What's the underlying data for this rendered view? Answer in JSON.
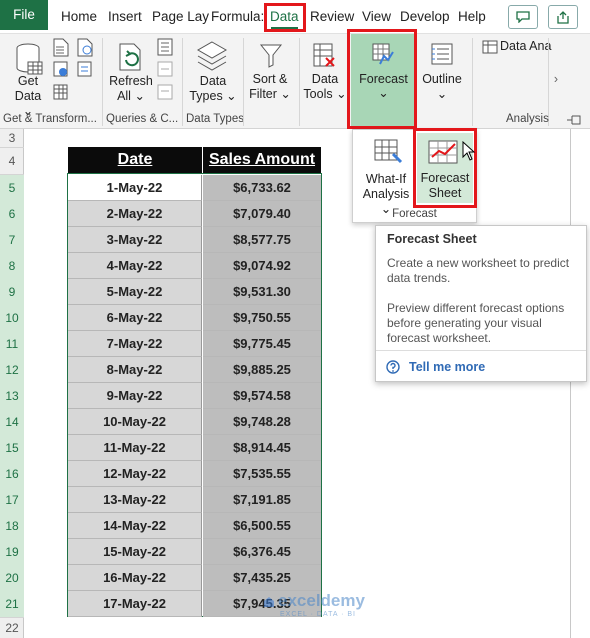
{
  "menu": {
    "tabs": [
      "File",
      "Home",
      "Insert",
      "Page Lay",
      "Formula:",
      "Data",
      "Review",
      "View",
      "Develop",
      "Help"
    ]
  },
  "ribbon": {
    "get_data": "Get",
    "get_data2": "Data",
    "refresh": "Refresh",
    "refresh2": "All",
    "data_types": "Data",
    "data_types2": "Types",
    "sort_filter": "Sort &",
    "sort_filter2": "Filter",
    "data_tools": "Data",
    "data_tools2": "Tools",
    "forecast": "Forecast",
    "outline": "Outline",
    "data_analysis": "Data Ana",
    "group_get_transform": "Get & Transform...",
    "group_queries": "Queries & C...",
    "group_data_types": "Data Types",
    "group_analysis": "Analysis"
  },
  "dropdown": {
    "what_if": "What-If",
    "what_if2": "Analysis",
    "forecast_sheet": "Forecast",
    "forecast_sheet2": "Sheet",
    "group_label": "Forecast"
  },
  "tooltip": {
    "title": "Forecast Sheet",
    "desc1": "Create a new worksheet to predict data trends.",
    "desc2": "Preview different forecast options before generating your visual forecast worksheet.",
    "link": "Tell me more"
  },
  "rows": [
    "3",
    "4",
    "5",
    "6",
    "7",
    "8",
    "9",
    "10",
    "11",
    "12",
    "13",
    "14",
    "15",
    "16",
    "17",
    "18",
    "19",
    "20",
    "21",
    "22"
  ],
  "table": {
    "header_date": "Date",
    "header_amount": "Sales Amount",
    "records": [
      {
        "date": "1-May-22",
        "amount": "$6,733.62"
      },
      {
        "date": "2-May-22",
        "amount": "$7,079.40"
      },
      {
        "date": "3-May-22",
        "amount": "$8,577.75"
      },
      {
        "date": "4-May-22",
        "amount": "$9,074.92"
      },
      {
        "date": "5-May-22",
        "amount": "$9,531.30"
      },
      {
        "date": "6-May-22",
        "amount": "$9,750.55"
      },
      {
        "date": "7-May-22",
        "amount": "$9,775.45"
      },
      {
        "date": "8-May-22",
        "amount": "$9,885.25"
      },
      {
        "date": "9-May-22",
        "amount": "$9,574.58"
      },
      {
        "date": "10-May-22",
        "amount": "$9,748.28"
      },
      {
        "date": "11-May-22",
        "amount": "$8,914.45"
      },
      {
        "date": "12-May-22",
        "amount": "$7,535.55"
      },
      {
        "date": "13-May-22",
        "amount": "$7,191.85"
      },
      {
        "date": "14-May-22",
        "amount": "$6,500.55"
      },
      {
        "date": "15-May-22",
        "amount": "$6,376.45"
      },
      {
        "date": "16-May-22",
        "amount": "$7,435.25"
      },
      {
        "date": "17-May-22",
        "amount": "$7,945.35"
      }
    ]
  },
  "watermark": "exceldemy",
  "watermark_sub": "EXCEL · DATA · BI",
  "colors": {
    "accent": "#1e7145",
    "highlight": "#e3171b",
    "forecast_bg": "#a8d6b6"
  }
}
